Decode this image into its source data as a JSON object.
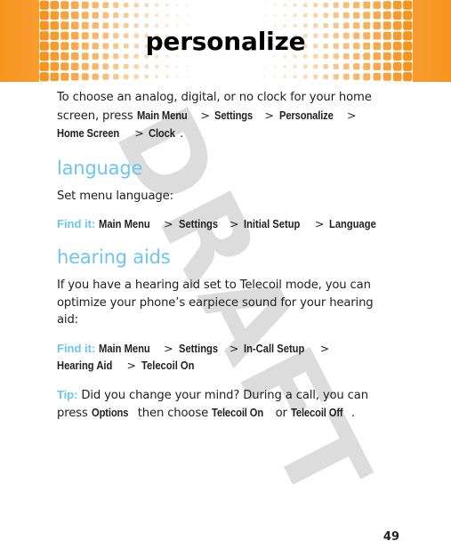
{
  "page": {
    "title": "personalize",
    "number": "49",
    "watermark": "DRAFT",
    "colors": {
      "banner_orange": "#f7941e",
      "heading_blue": "#6dc6ee",
      "body_text": "#231f20",
      "watermark_grey": "#dcdcdc"
    }
  },
  "intro": {
    "text_before": "To choose an analog, digital, or no clock for your home screen, press ",
    "path": [
      "Main Menu",
      "Settings",
      "Personalize",
      "Home Screen",
      "Clock"
    ],
    "separator": ">",
    "text_after": "."
  },
  "sections": [
    {
      "heading": "language",
      "body": "Set menu language:",
      "find_label": "Find it:",
      "find_path": [
        "Main Menu",
        "Settings",
        "Initial Setup",
        "Language"
      ]
    },
    {
      "heading": "hearing aids",
      "body": "If you have a hearing aid set to Telecoil mode, you can optimize your phone’s earpiece sound for your hearing aid:",
      "find_label": "Find it:",
      "find_path": [
        "Main Menu",
        "Settings",
        "In-Call Setup",
        "Hearing Aid",
        "Telecoil On"
      ]
    }
  ],
  "tip": {
    "label": "Tip:",
    "text_1": " Did you change your mind? During a call, you can press ",
    "emphasis_1": "Options",
    "text_2": " then choose ",
    "emphasis_2": "Telecoil On",
    "text_3": " or ",
    "emphasis_3": "Telecoil Off",
    "text_4": "."
  }
}
